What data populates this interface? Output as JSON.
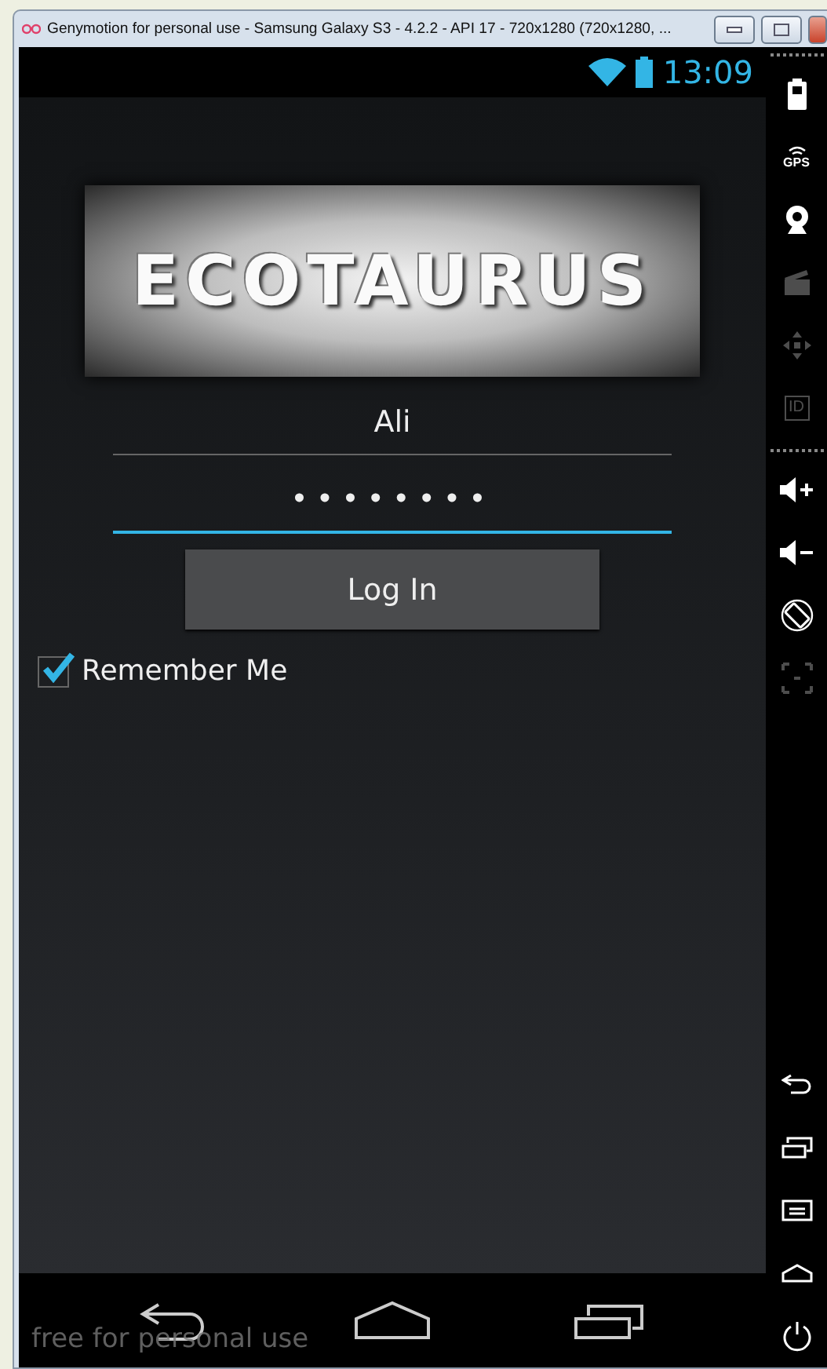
{
  "window": {
    "title": "Genymotion for personal use - Samsung Galaxy S3 - 4.2.2 - API 17 - 720x1280 (720x1280, ..."
  },
  "status_bar": {
    "time": "13:09"
  },
  "logo": {
    "text": "ECOTAURUS"
  },
  "login_form": {
    "username": {
      "value": "Ali",
      "focused": false
    },
    "password": {
      "value": "••••••••",
      "focused": true
    },
    "button": "Log In",
    "remember_me": {
      "label": "Remember Me",
      "checked": true
    }
  },
  "nav_bar": {
    "buttons": [
      {
        "kind": "back"
      },
      {
        "kind": "home"
      },
      {
        "kind": "recent"
      }
    ]
  },
  "watermark": "free for personal use",
  "side_toolbar": {
    "top": [
      {
        "kind": "battery",
        "disabled": false
      },
      {
        "kind": "gps",
        "label": "GPS",
        "disabled": false
      },
      {
        "kind": "webcam",
        "disabled": false
      },
      {
        "kind": "clapper",
        "disabled": true
      },
      {
        "kind": "dpad",
        "disabled": true
      },
      {
        "kind": "id",
        "label": "ID",
        "disabled": true
      }
    ],
    "middle": [
      {
        "kind": "volume-up",
        "disabled": false
      },
      {
        "kind": "volume-down",
        "disabled": false
      },
      {
        "kind": "rotate",
        "disabled": false
      },
      {
        "kind": "scale",
        "disabled": true
      }
    ],
    "bottom": [
      {
        "kind": "back",
        "disabled": false
      },
      {
        "kind": "recent",
        "disabled": false
      },
      {
        "kind": "menu",
        "disabled": false
      },
      {
        "kind": "home",
        "disabled": false
      },
      {
        "kind": "power",
        "disabled": false
      }
    ]
  }
}
